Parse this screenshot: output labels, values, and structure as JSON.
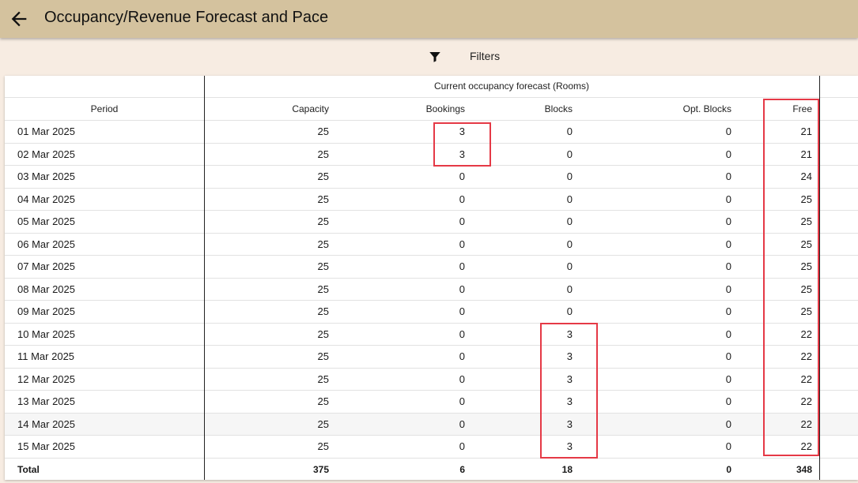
{
  "header": {
    "title": "Occupancy/Revenue Forecast and Pace",
    "back_icon": "arrow-left-icon"
  },
  "toolbar": {
    "filter_icon": "filter-icon",
    "filter_label": "Filters"
  },
  "table": {
    "group_header": "Current occupancy forecast (Rooms)",
    "columns": [
      "Period",
      "Capacity",
      "Bookings",
      "Blocks",
      "Opt. Blocks",
      "Free"
    ],
    "rows": [
      [
        "01 Mar 2025",
        "25",
        "3",
        "0",
        "0",
        "21"
      ],
      [
        "02 Mar 2025",
        "25",
        "3",
        "0",
        "0",
        "21"
      ],
      [
        "03 Mar 2025",
        "25",
        "0",
        "0",
        "0",
        "24"
      ],
      [
        "04 Mar 2025",
        "25",
        "0",
        "0",
        "0",
        "25"
      ],
      [
        "05 Mar 2025",
        "25",
        "0",
        "0",
        "0",
        "25"
      ],
      [
        "06 Mar 2025",
        "25",
        "0",
        "0",
        "0",
        "25"
      ],
      [
        "07 Mar 2025",
        "25",
        "0",
        "0",
        "0",
        "25"
      ],
      [
        "08 Mar 2025",
        "25",
        "0",
        "0",
        "0",
        "25"
      ],
      [
        "09 Mar 2025",
        "25",
        "0",
        "0",
        "0",
        "25"
      ],
      [
        "10 Mar 2025",
        "25",
        "0",
        "3",
        "0",
        "22"
      ],
      [
        "11 Mar 2025",
        "25",
        "0",
        "3",
        "0",
        "22"
      ],
      [
        "12 Mar 2025",
        "25",
        "0",
        "3",
        "0",
        "22"
      ],
      [
        "13 Mar 2025",
        "25",
        "0",
        "3",
        "0",
        "22"
      ],
      [
        "14 Mar 2025",
        "25",
        "0",
        "3",
        "0",
        "22"
      ],
      [
        "15 Mar 2025",
        "25",
        "0",
        "3",
        "0",
        "22"
      ]
    ],
    "total": [
      "Total",
      "375",
      "6",
      "18",
      "0",
      "348"
    ]
  },
  "colors": {
    "appbar": "#d4c29e",
    "page_bg": "#f7ece2",
    "highlight": "#e53946"
  }
}
